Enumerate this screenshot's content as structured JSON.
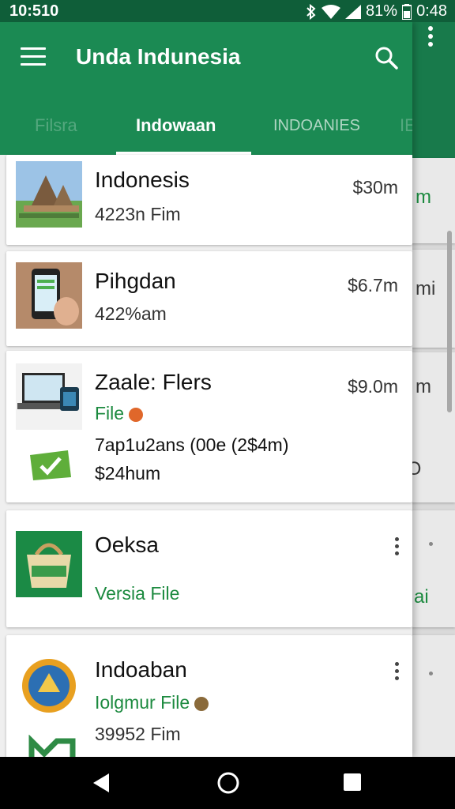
{
  "status_bar": {
    "time_left": "10:510",
    "battery": "81%",
    "time_right": "0:48"
  },
  "app_bar": {
    "title": "Unda Indunesia"
  },
  "tabs": [
    {
      "label": "Filsra"
    },
    {
      "label": "Indowaan"
    },
    {
      "label": "INDOANIES"
    },
    {
      "label": "IES"
    }
  ],
  "cards": [
    {
      "title": "Indonesis",
      "subtitle": "4223n Fim",
      "price": "$30m"
    },
    {
      "title": "Pihgdan",
      "subtitle": "422%am",
      "price": "$6.7m"
    },
    {
      "title": "Zaale: Flers",
      "tag": "File",
      "line2": "7ap1u2ans (00e (2$4m)",
      "line3": "$24hum",
      "price": "$9.0m"
    },
    {
      "title": "Oeksa",
      "tag": "Versia File"
    },
    {
      "title": "Indoaban",
      "tag": "Iolgmur File",
      "subtitle": "39952 Fim"
    }
  ],
  "background_pane": {
    "fragments": [
      "m",
      "mi",
      "m",
      "Ɔ",
      "ai"
    ]
  },
  "colors": {
    "app_bar": "#1b8a53",
    "status_bar": "#0f5e39",
    "accent_green": "#1c8a3f"
  }
}
